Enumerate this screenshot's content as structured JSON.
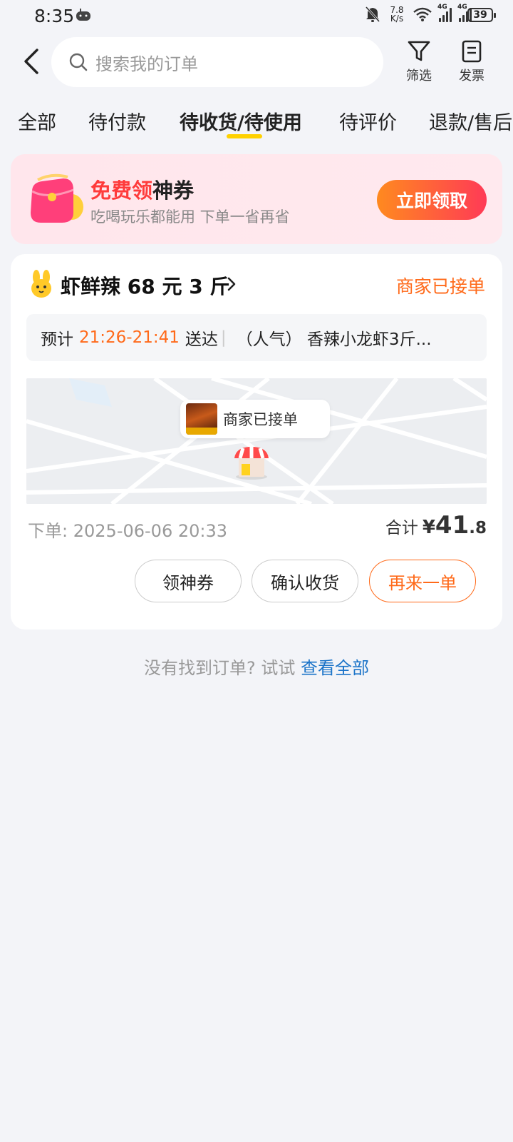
{
  "status_bar": {
    "time": "8:35",
    "net_speed_value": "7.8",
    "net_speed_unit": "K/s",
    "signal1_label": "4G",
    "signal2_label": "4G",
    "battery": "39"
  },
  "header": {
    "search_placeholder": "搜索我的订单",
    "filter_label": "筛选",
    "invoice_label": "发票"
  },
  "tabs": [
    {
      "label": "全部"
    },
    {
      "label": "待付款"
    },
    {
      "label": "待收货/待使用",
      "active": true
    },
    {
      "label": "待评价"
    },
    {
      "label": "退款/售后"
    }
  ],
  "coupon": {
    "title_highlight": "免费领",
    "title_rest": "神券",
    "subtitle": "吃喝玩乐都能用 下单一省再省",
    "button": "立即领取"
  },
  "order": {
    "store_name": "虾鲜辣 68 元 3 斤",
    "status": "商家已接单",
    "eta_prefix": "预计",
    "eta_time": "21:26-21:41",
    "eta_suffix": "送达",
    "item_summary": "（人气） 香辣小龙虾3斤...",
    "map_status": "商家已接单",
    "order_time_label": "下单:",
    "order_time": "2025-06-06 20:33",
    "total_label": "合计",
    "total_currency": "¥",
    "total_int": "41",
    "total_dec": ".8",
    "buttons": {
      "coupon": "领神券",
      "confirm": "确认收货",
      "reorder": "再来一单"
    }
  },
  "footer": {
    "hint": "没有找到订单? 试试",
    "link": "查看全部"
  },
  "colors": {
    "accent_orange": "#ff6a1a",
    "tab_indicator": "#ffd100",
    "link_blue": "#1a73c8"
  }
}
